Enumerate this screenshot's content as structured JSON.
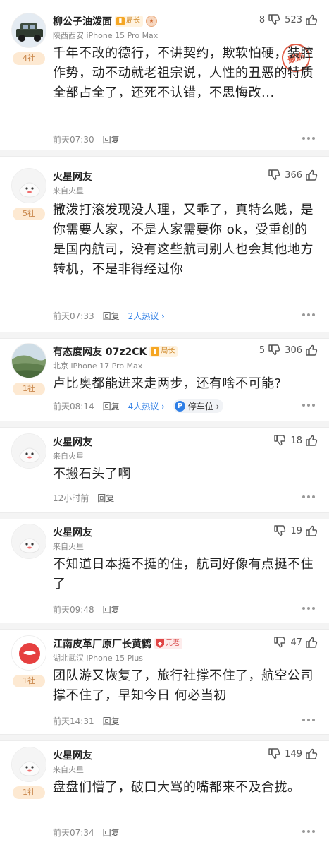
{
  "comments": [
    {
      "name": "柳公子油泼面",
      "tag": {
        "type": "gold",
        "label": "局长"
      },
      "medal": true,
      "sub": "陕西西安 iPhone 15 Pro Max",
      "badge": "4社",
      "dislikes": "8",
      "likes": "523",
      "stamp": "最热",
      "text": "千年不改的德行，不讲契约，欺软怕硬，装腔作势，动不动就老祖宗说，人性的丑恶的特质全部占全了，还死不认错，不思悔改...",
      "time": "前天07:30",
      "reply": "回复"
    },
    {
      "name": "火星网友",
      "sub": "来自火星",
      "badge": "5社",
      "likes": "366",
      "text": "撒泼打滚发现没人理，又乖了，真特么贱，是你需要人家，不是人家需要你 ok，受重创的是国内航司，没有这些航司别人也会其他地方转机，不是非得经过你",
      "time": "前天07:33",
      "reply": "回复",
      "hot": "2人热议 ›"
    },
    {
      "name": "有态度网友 07z2CK",
      "tag": {
        "type": "gold",
        "label": "局长"
      },
      "sub": "北京 iPhone 17 Pro Max",
      "badge": "1社",
      "dislikes": "5",
      "likes": "306",
      "text": "卢比奥都能进来走两步，还有啥不可能?",
      "time": "前天08:14",
      "reply": "回复",
      "hot": "4人热议 ›",
      "chip": "停车位 ›"
    },
    {
      "name": "火星网友",
      "sub": "来自火星",
      "likes": "18",
      "text": "不搬石头了啊",
      "time": "12小时前",
      "reply": "回复"
    },
    {
      "name": "火星网友",
      "sub": "来自火星",
      "likes": "19",
      "text": "不知道日本挺不挺的住，航司好像有点挺不住了",
      "time": "前天09:48",
      "reply": "回复"
    },
    {
      "name": "江南皮革厂原厂长黄鹤",
      "tag": {
        "type": "red",
        "label": "元老"
      },
      "sub": "湖北武汉 iPhone 15 Plus",
      "badge": "1社",
      "likes": "47",
      "text": "团队游又恢复了，旅行社撑不住了，航空公司撑不住了，早知今日 何必当初",
      "time": "前天14:31",
      "reply": "回复"
    },
    {
      "name": "火星网友",
      "sub": "来自火星",
      "badge": "1社",
      "likes": "149",
      "text": "盘盘们懵了，破口大骂的嘴都来不及合拢。",
      "time": "前天07:34",
      "reply": "回复"
    }
  ]
}
